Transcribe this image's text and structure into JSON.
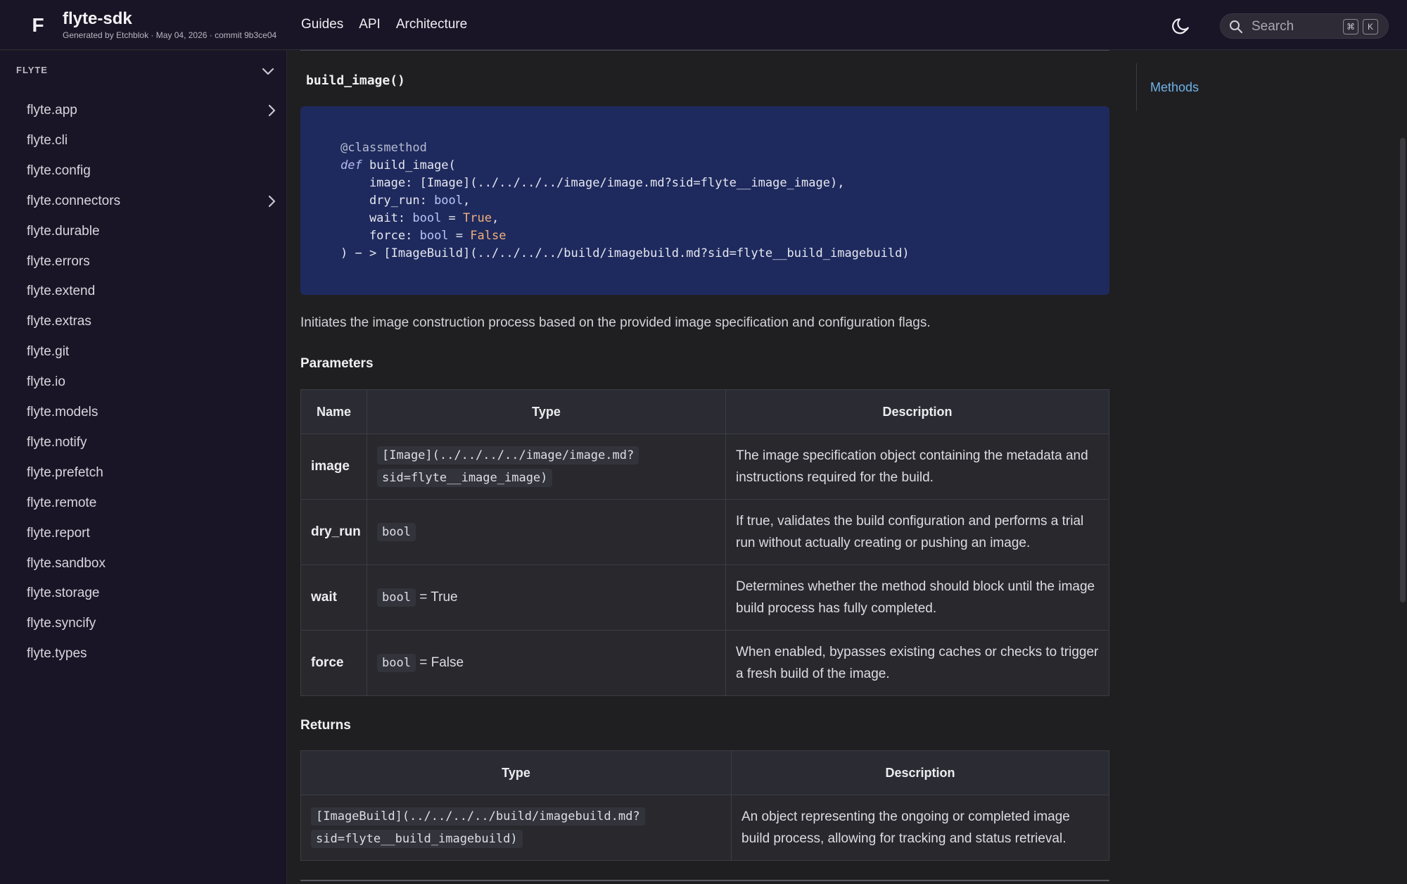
{
  "header": {
    "logo": "F",
    "title": "flyte-sdk",
    "subtitle": "Generated by Etchblok · May 04, 2026 · commit 9b3ce04",
    "nav": [
      "Guides",
      "API",
      "Architecture"
    ],
    "search_placeholder": "Search",
    "shortcut_keys": [
      "⌘",
      "K"
    ]
  },
  "sidebar": {
    "section": "FLYTE",
    "items": [
      {
        "label": "flyte.app",
        "expandable": true
      },
      {
        "label": "flyte.cli",
        "expandable": false
      },
      {
        "label": "flyte.config",
        "expandable": false
      },
      {
        "label": "flyte.connectors",
        "expandable": true
      },
      {
        "label": "flyte.durable",
        "expandable": false
      },
      {
        "label": "flyte.errors",
        "expandable": false
      },
      {
        "label": "flyte.extend",
        "expandable": false
      },
      {
        "label": "flyte.extras",
        "expandable": false
      },
      {
        "label": "flyte.git",
        "expandable": false
      },
      {
        "label": "flyte.io",
        "expandable": false
      },
      {
        "label": "flyte.models",
        "expandable": false
      },
      {
        "label": "flyte.notify",
        "expandable": false
      },
      {
        "label": "flyte.prefetch",
        "expandable": false
      },
      {
        "label": "flyte.remote",
        "expandable": false
      },
      {
        "label": "flyte.report",
        "expandable": false
      },
      {
        "label": "flyte.sandbox",
        "expandable": false
      },
      {
        "label": "flyte.storage",
        "expandable": false
      },
      {
        "label": "flyte.syncify",
        "expandable": false
      },
      {
        "label": "flyte.types",
        "expandable": false
      }
    ]
  },
  "main": {
    "method_title": "build_image()",
    "code": {
      "decorator": "@classmethod",
      "def_kw": "def",
      "func_sig": " build_image(",
      "line_image": "    image: [Image](../../../../image/image.md?sid=flyte__image_image),",
      "line_dry_a": "    dry_run: ",
      "line_dry_t": "bool",
      "line_dry_b": ",",
      "line_wait_a": "    wait: ",
      "line_wait_t": "bool",
      "line_wait_eq": " = ",
      "line_wait_v": "True",
      "line_wait_b": ",",
      "line_force_a": "    force: ",
      "line_force_t": "bool",
      "line_force_eq": " = ",
      "line_force_v": "False",
      "line_ret": ") − > [ImageBuild](../../../../build/imagebuild.md?sid=flyte__build_imagebuild)"
    },
    "description": "Initiates the image construction process based on the provided image specification and configuration flags.",
    "parameters_heading": "Parameters",
    "param_headers": [
      "Name",
      "Type",
      "Description"
    ],
    "params": [
      {
        "name": "image",
        "type_line1": "[Image](../../../../image/image.md?",
        "type_line2": "sid=flyte__image_image)",
        "default": "",
        "desc": "The image specification object containing the metadata and instructions required for the build."
      },
      {
        "name": "dry_run",
        "type": "bool",
        "default": "",
        "desc": "If true, validates the build configuration and performs a trial run without actually creating or pushing an image."
      },
      {
        "name": "wait",
        "type": "bool",
        "default": "= True",
        "desc": "Determines whether the method should block until the image build process has fully completed."
      },
      {
        "name": "force",
        "type": "bool",
        "default": "= False",
        "desc": "When enabled, bypasses existing caches or checks to trigger a fresh build of the image."
      }
    ],
    "returns_heading": "Returns",
    "return_headers": [
      "Type",
      "Description"
    ],
    "returns": {
      "type_line1": "[ImageBuild](../../../../build/imagebuild.md?",
      "type_line2": "sid=flyte__build_imagebuild)",
      "desc": "An object representing the ongoing or completed image build process, allowing for tracking and status retrieval."
    }
  },
  "toc": {
    "link": "Methods"
  },
  "colors": {
    "accent_link": "#6fb2e6",
    "code_bg": "#1e2a5e",
    "sidebar_bg": "#1a1526"
  }
}
